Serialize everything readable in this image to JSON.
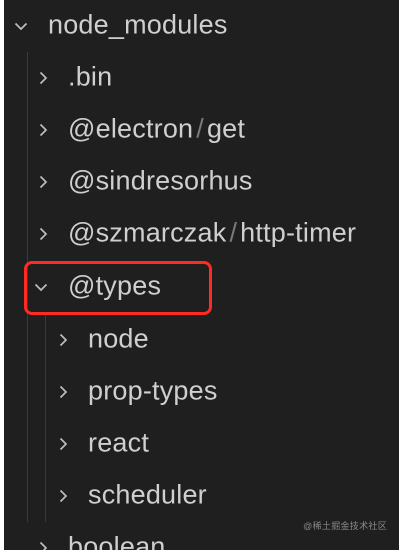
{
  "tree": {
    "root": {
      "label": "node_modules",
      "expanded": true
    },
    "items": [
      {
        "label": ".bin",
        "expanded": false
      },
      {
        "label": "@electron",
        "label2": "get",
        "expanded": false
      },
      {
        "label": "@sindresorhus",
        "expanded": false
      },
      {
        "label": "@szmarczak",
        "label2": "http-timer",
        "expanded": false
      },
      {
        "label": "@types",
        "expanded": true,
        "highlighted": true,
        "children": [
          {
            "label": "node",
            "expanded": false
          },
          {
            "label": "prop-types",
            "expanded": false
          },
          {
            "label": "react",
            "expanded": false
          },
          {
            "label": "scheduler",
            "expanded": false
          }
        ]
      },
      {
        "label": "boolean",
        "expanded": false
      }
    ],
    "highlight_color": "#ff2b22"
  },
  "watermark": "@稀土掘金技术社区"
}
